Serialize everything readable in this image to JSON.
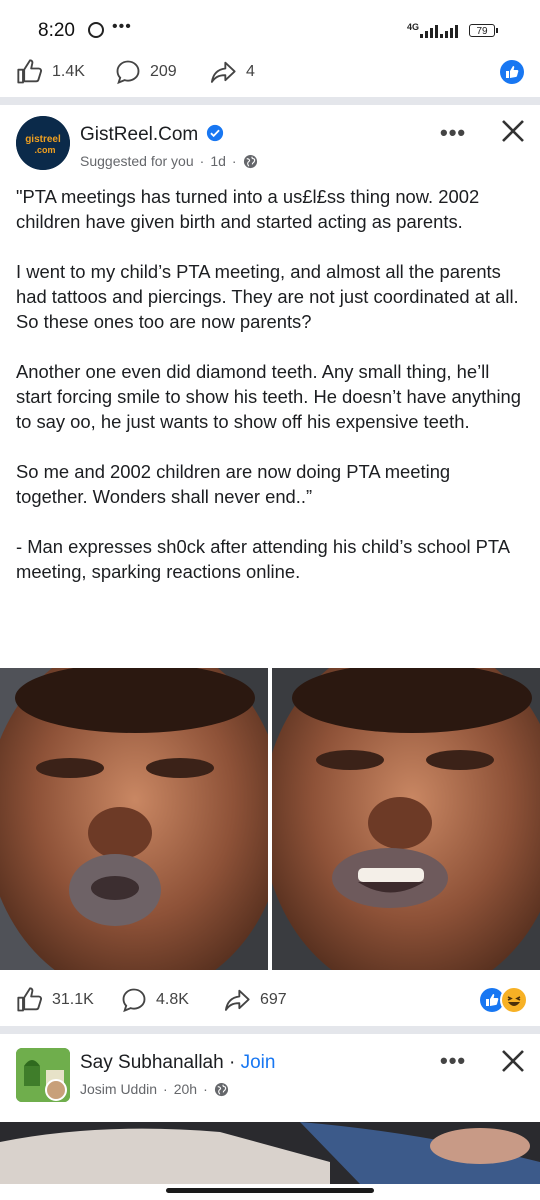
{
  "status_bar": {
    "time": "8:20",
    "network": "4G",
    "battery": "79"
  },
  "top_actions": {
    "likes": "1.4K",
    "comments": "209",
    "shares": "4"
  },
  "post": {
    "page_name": "GistReel.Com",
    "avatar_text": "gistreel .com",
    "suggested": "Suggested for you",
    "time": "1d",
    "paragraphs": [
      "\"PTA meetings has turned into a us£l£ss thing now. 2002 children have given birth and started acting as parents.",
      "I went to my child’s PTA meeting, and almost all the parents had tattoos and piercings. They are not just coordinated at all. So these ones too are now parents?",
      "Another one even did diamond teeth. Any small thing, he’ll start forcing smile to show his teeth. He doesn’t have anything to say oo, he just wants to show off his expensive teeth.",
      "So me and 2002 children are now doing PTA meeting together. Wonders shall never end..”",
      "- Man expresses sh0ck after attending his child’s school PTA meeting, sparking reactions online."
    ],
    "likes": "31.1K",
    "comments": "4.8K",
    "shares": "697"
  },
  "next_post": {
    "group_name": "Say Subhanallah",
    "join_label": "Join",
    "author": "Josim Uddin",
    "time": "20h"
  },
  "colors": {
    "brand_blue": "#1877f2",
    "divider": "#e4e6eb",
    "secondary_text": "#65676b",
    "haha_yellow": "#f7b125",
    "avatar_bg": "#0b2a4a",
    "avatar_text": "#f0a020"
  }
}
